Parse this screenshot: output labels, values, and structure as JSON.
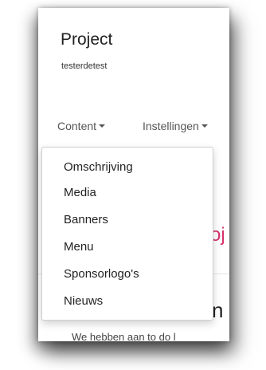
{
  "project": {
    "title": "Project",
    "subtitle": "testerdetest"
  },
  "navbar": {
    "content_label": "Content",
    "settings_label": "Instellingen"
  },
  "dropdown": {
    "items": [
      {
        "label": "Omschrijving"
      },
      {
        "label": "Media"
      },
      {
        "label": "Banners"
      },
      {
        "label": "Menu"
      },
      {
        "label": "Sponsorlogo's"
      },
      {
        "label": "Nieuws"
      }
    ]
  },
  "background": {
    "heading_fragment": "oj",
    "section_title_fragment": "n",
    "paragraph_fragment": "We hebben aan to do l"
  },
  "colors": {
    "accent_heading": "#d6336c",
    "nav_text": "#555555"
  }
}
